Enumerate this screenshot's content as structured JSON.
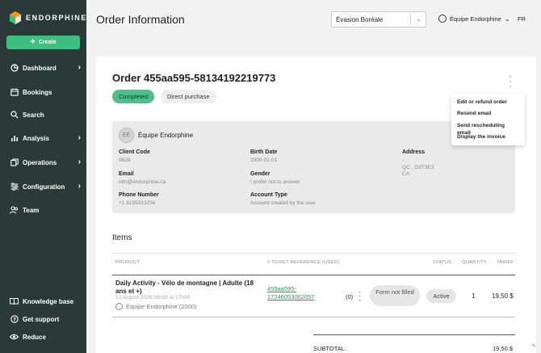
{
  "brand": {
    "name": "ENDORPHINE"
  },
  "sidebar": {
    "create_label": "Create",
    "items": [
      {
        "label": "Dashboard",
        "icon": "pie-chart-icon",
        "chevron": true
      },
      {
        "label": "Bookings",
        "icon": "calendar-icon",
        "chevron": false
      },
      {
        "label": "Search",
        "icon": "search-icon",
        "chevron": false
      },
      {
        "label": "Analysis",
        "icon": "bar-chart-icon",
        "chevron": true
      },
      {
        "label": "Operations",
        "icon": "operations-icon",
        "chevron": true
      },
      {
        "label": "Configuration",
        "icon": "sliders-icon",
        "chevron": true
      },
      {
        "label": "Team",
        "icon": "team-icon",
        "chevron": false
      }
    ],
    "bottom_items": [
      {
        "label": "Knowledge base",
        "icon": "book-icon"
      },
      {
        "label": "Get support",
        "icon": "help-icon"
      },
      {
        "label": "Reduce",
        "icon": "eye-icon"
      }
    ]
  },
  "header": {
    "title": "Order Information",
    "company_select": "Évasion Boréale",
    "user_name": "Équipe Endorphine",
    "language": "FR"
  },
  "order": {
    "title": "Order 455aa595-58134192219773",
    "status_chip": "Completed",
    "type_chip": "Direct purchase"
  },
  "actions_menu": [
    "Edit or refund order",
    "Resend email",
    "Send rescheduling email",
    "Display the invoice"
  ],
  "customer": {
    "initials": "EE",
    "name": "Équipe Endorphine",
    "client_code_label": "Client Code",
    "client_code": "9628",
    "birth_date_label": "Birth Date",
    "birth_date": "2000-01-01",
    "address_label": "Address",
    "address_line1": "-",
    "address_line2": "QC , G9T3E3",
    "address_line3": "CA",
    "email_label": "Email",
    "email": "info@endorphine.ca",
    "gender_label": "Gender",
    "gender": "I prefer not to answer",
    "phone_label": "Phone Number",
    "phone": "+1 8195313256",
    "account_type_label": "Account Type",
    "account_type": "Account created by the user"
  },
  "items": {
    "title": "Items",
    "columns": {
      "product": "PRODUCT",
      "ticket_ref": "# TICKET REFERENCE (USED)",
      "status": "STATUS",
      "quantity": "QUANTITY",
      "tariff": "TARIFF"
    },
    "rows": [
      {
        "product": "Daily Activity - Vélo de montagne | Adulte (18 ans et +)",
        "date": "13 August 2026 08h30 at 17h00",
        "team": "Équipe Endorphine (2000)",
        "ticket_ref": "455aa595-17246053062657",
        "used_count": "(0)",
        "form_status": "Form not filled",
        "status": "Active",
        "quantity": "1",
        "tariff": "19,50 $"
      }
    ],
    "subtotal_label": "SUBTOTAL:",
    "subtotal_value": "19,50 $"
  },
  "colors": {
    "sidebar_bg": "#2b3a38",
    "accent_green": "#3fbf7f",
    "completed_chip": "#4cbf8a",
    "link_green": "#2a9a56"
  }
}
